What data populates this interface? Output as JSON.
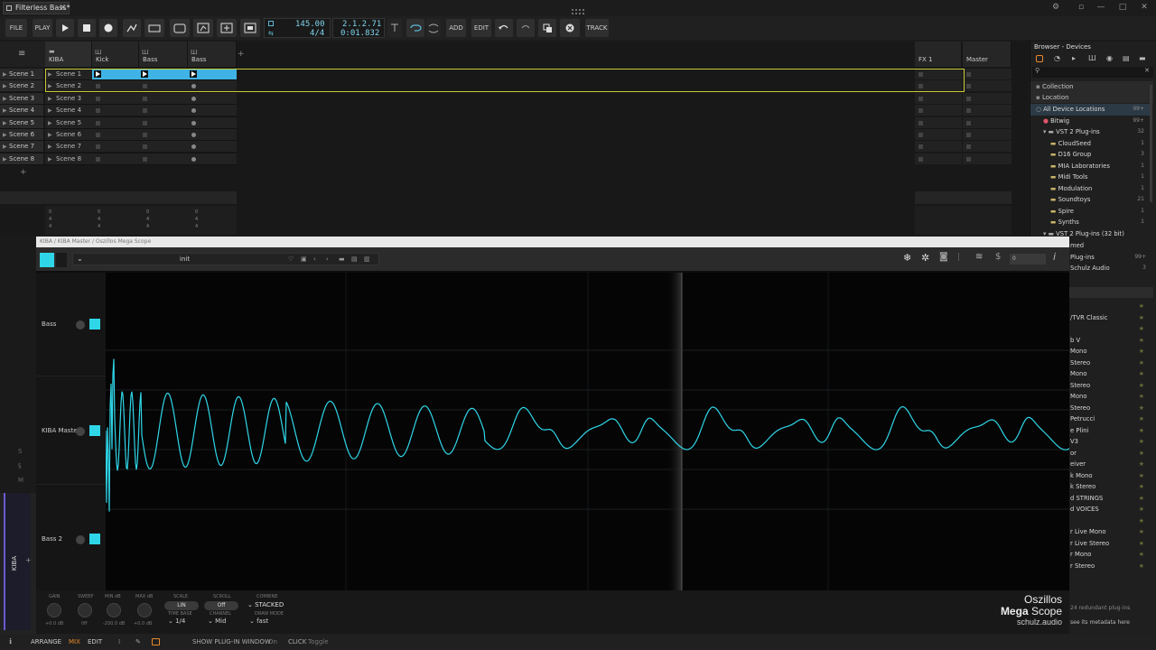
{
  "window": {
    "tab_title": "Filterless Bass*",
    "close_glyph": "✕",
    "minimize_glyph": "—",
    "maximize_glyph": "□",
    "win_close_glyph": "✕"
  },
  "toolbar": {
    "file": "FILE",
    "play_label": "PLAY",
    "tempo": "145.00",
    "time_sig": "4/4",
    "position_bars": "2.1.2.71",
    "position_time": "0:01.832",
    "add": "ADD",
    "edit": "EDIT",
    "track": "TRACK"
  },
  "launcher": {
    "tracks": [
      {
        "name": "KIBA"
      },
      {
        "name": "Kick"
      },
      {
        "name": "Bass"
      },
      {
        "name": "Bass"
      }
    ],
    "fx_tracks": [
      {
        "name": "FX 1"
      },
      {
        "name": "Master"
      }
    ],
    "scenes": [
      "Scene 1",
      "Scene 2",
      "Scene 3",
      "Scene 4",
      "Scene 5",
      "Scene 6",
      "Scene 7",
      "Scene 8"
    ],
    "add_glyph": "+",
    "meter_labels": [
      "0",
      "4",
      "4",
      "0",
      "4",
      "4",
      "0",
      "4",
      "4",
      "0",
      "4",
      "4",
      "0",
      "4",
      "4",
      "0",
      "4",
      "4"
    ]
  },
  "browser": {
    "title": "Browser - Devices",
    "search_placeholder": "",
    "collection": "Collection",
    "location": "Location",
    "items": [
      {
        "label": "All Device Locations",
        "count": "99+",
        "indent": 0
      },
      {
        "label": "Bitwig",
        "count": "99+",
        "indent": 1
      },
      {
        "label": "VST 2 Plug-ins",
        "count": "32",
        "indent": 1
      },
      {
        "label": "CloudSeed",
        "count": "1",
        "indent": 2
      },
      {
        "label": "D16 Group",
        "count": "3",
        "indent": 2
      },
      {
        "label": "MIA Laboratories",
        "count": "1",
        "indent": 2
      },
      {
        "label": "Midi Tools",
        "count": "1",
        "indent": 2
      },
      {
        "label": "Modulation",
        "count": "1",
        "indent": 2
      },
      {
        "label": "Soundtoys",
        "count": "21",
        "indent": 2
      },
      {
        "label": "Spire",
        "count": "1",
        "indent": 2
      },
      {
        "label": "Synths",
        "count": "1",
        "indent": 2
      },
      {
        "label": "VST 2 Plug-ins (32 bit)",
        "count": "",
        "indent": 1
      }
    ],
    "partial_items": [
      "med",
      "Plug-ins",
      "Schulz Audio"
    ],
    "partial_counts": [
      "",
      "99+",
      "3"
    ],
    "results": [
      "",
      "/TVR Classic",
      "",
      "b V",
      "Mono",
      "Stereo",
      "Mono",
      "Stereo",
      "Mono",
      "Stereo",
      "Petrucci",
      "e Plini",
      "V3",
      "or",
      "eiver",
      "k Mono",
      "k Stereo",
      "d STRINGS",
      "d VOICES",
      "",
      "r Live Mono",
      "r Live Stereo",
      "r Mono",
      "r Stereo"
    ],
    "footer1": "24 redundant plug-ins",
    "footer2": "see its metadata here"
  },
  "plugin": {
    "path": "KIBA / KIBA Master / Oszillos Mega Scope",
    "preset": "init",
    "value_box": "0",
    "channels": [
      {
        "name": "Bass"
      },
      {
        "name": "KIBA Master"
      },
      {
        "name": "Bass 2"
      }
    ],
    "controls": {
      "gain_label": "GAIN",
      "gain_value": "+0.0 dB",
      "sweep_label": "SWEEP",
      "sweep_value": "0ff",
      "min_db_label": "MIN dB",
      "min_db_value": "-200.0 dB",
      "max_db_label": "MAX dB",
      "max_db_value": "+0.0 dB",
      "scale_label": "SCALE",
      "scale_value": "LIN",
      "scroll_label": "SCROLL",
      "scroll_value": "Off",
      "combine_label": "COMBINE",
      "combine_value": "STACKED",
      "timebase_label": "TIME BASE",
      "timebase_value": "1/4",
      "channel_label": "CHANNEL",
      "channel_value": "Mid",
      "drawmode_label": "DRAW MODE",
      "drawmode_value": "fast"
    },
    "brand_line1": "Oszillos",
    "brand_mega": "Mega",
    "brand_scope": "Scope",
    "brand_line3": "schulz.audio",
    "accent": "#2fd6e8"
  },
  "bottombar": {
    "arrange": "ARRANGE",
    "mix": "MIX",
    "edit": "EDIT",
    "show_plugin_window": "SHOW PLUG-IN WINDOW",
    "on": "On",
    "click": "CLICK",
    "toggle": "Toggle"
  },
  "side_track": {
    "label": "KIBA"
  }
}
